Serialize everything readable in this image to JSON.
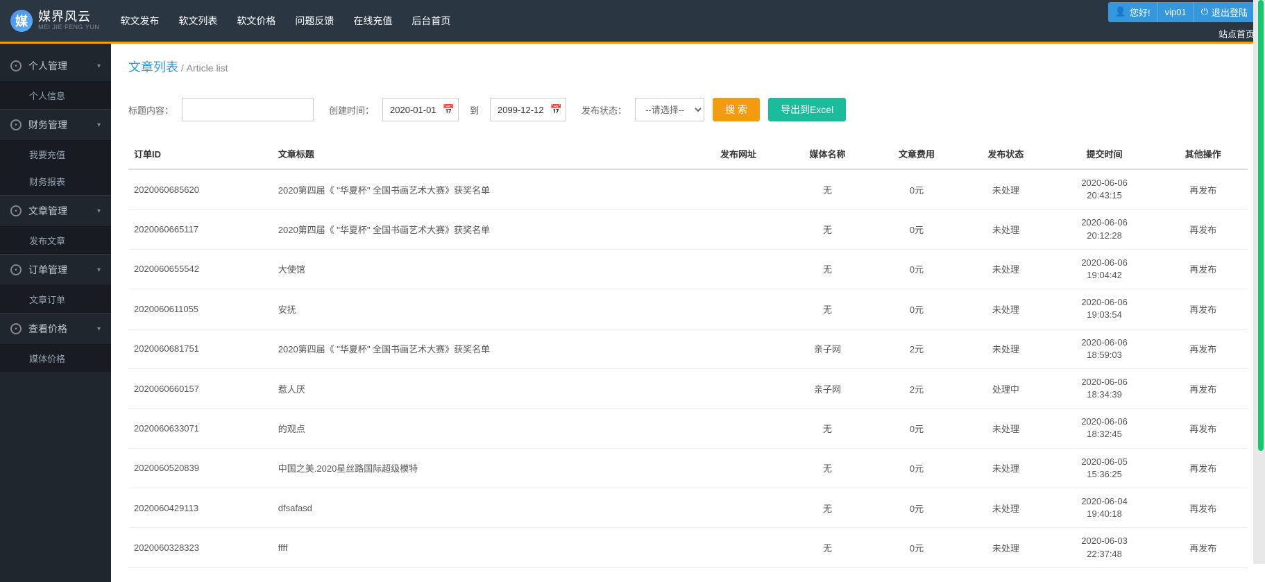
{
  "brand": {
    "icon_text": "媒",
    "name_cn": "媒界风云",
    "name_en": "MEI JIE FENG YUN"
  },
  "top_nav": [
    "软文发布",
    "软文列表",
    "软文价格",
    "问题反馈",
    "在线充值",
    "后台首页"
  ],
  "user_area": {
    "greeting": "您好!",
    "username": "vip01",
    "logout": "退出登陆",
    "site_home": "站点首页"
  },
  "sidebar": [
    {
      "label": "个人管理",
      "items": [
        "个人信息"
      ]
    },
    {
      "label": "财务管理",
      "items": [
        "我要充值",
        "财务报表"
      ]
    },
    {
      "label": "文章管理",
      "items": [
        "发布文章"
      ]
    },
    {
      "label": "订单管理",
      "items": [
        "文章订单"
      ]
    },
    {
      "label": "查看价格",
      "items": [
        "媒体价格"
      ]
    }
  ],
  "page": {
    "title_cn": "文章列表",
    "title_sep": " / ",
    "title_en": "Article list"
  },
  "filters": {
    "title_label": "标题内容：",
    "title_value": "",
    "create_time_label": "创建时间：",
    "date_from": "2020-01-01",
    "to_label": "到",
    "date_to": "2099-12-12",
    "status_label": "发布状态：",
    "status_placeholder": "--请选择--",
    "search_btn": "搜 索",
    "export_btn": "导出到Excel"
  },
  "table": {
    "headers": [
      "订单ID",
      "文章标题",
      "发布网址",
      "媒体名称",
      "文章费用",
      "发布状态",
      "提交时间",
      "其他操作"
    ],
    "rows": [
      {
        "id": "2020060685620",
        "title": "2020第四届《 \"华夏杯\" 全国书画艺术大赛》获奖名单",
        "url": "",
        "media": "无",
        "fee": "0元",
        "status": "未处理",
        "status_class": "green",
        "time1": "2020-06-06",
        "time2": "20:43:15",
        "action": "再发布"
      },
      {
        "id": "2020060665117",
        "title": "2020第四届《 \"华夏杯\" 全国书画艺术大赛》获奖名单",
        "url": "",
        "media": "无",
        "fee": "0元",
        "status": "未处理",
        "status_class": "green",
        "time1": "2020-06-06",
        "time2": "20:12:28",
        "action": "再发布"
      },
      {
        "id": "2020060655542",
        "title": "大使馆",
        "url": "",
        "media": "无",
        "fee": "0元",
        "status": "未处理",
        "status_class": "green",
        "time1": "2020-06-06",
        "time2": "19:04:42",
        "action": "再发布"
      },
      {
        "id": "2020060611055",
        "title": "安抚",
        "url": "",
        "media": "无",
        "fee": "0元",
        "status": "未处理",
        "status_class": "green",
        "time1": "2020-06-06",
        "time2": "19:03:54",
        "action": "再发布"
      },
      {
        "id": "2020060681751",
        "title": "2020第四届《 \"华夏杯\" 全国书画艺术大赛》获奖名单",
        "url": "",
        "media": "亲子网",
        "fee": "2元",
        "status": "未处理",
        "status_class": "green",
        "time1": "2020-06-06",
        "time2": "18:59:03",
        "action": "再发布"
      },
      {
        "id": "2020060660157",
        "title": "惹人厌",
        "url": "",
        "media": "亲子网",
        "fee": "2元",
        "status": "处理中",
        "status_class": "red",
        "time1": "2020-06-06",
        "time2": "18:34:39",
        "action": "再发布"
      },
      {
        "id": "2020060633071",
        "title": "的观点",
        "url": "",
        "media": "无",
        "fee": "0元",
        "status": "未处理",
        "status_class": "green",
        "time1": "2020-06-06",
        "time2": "18:32:45",
        "action": "再发布"
      },
      {
        "id": "2020060520839",
        "title": "中国之美.2020星丝路国际超级模特",
        "url": "",
        "media": "无",
        "fee": "0元",
        "status": "未处理",
        "status_class": "green",
        "time1": "2020-06-05",
        "time2": "15:36:25",
        "action": "再发布"
      },
      {
        "id": "2020060429113",
        "title": "dfsafasd",
        "url": "",
        "media": "无",
        "fee": "0元",
        "status": "未处理",
        "status_class": "green",
        "time1": "2020-06-04",
        "time2": "19:40:18",
        "action": "再发布"
      },
      {
        "id": "2020060328323",
        "title": "ffff",
        "url": "",
        "media": "无",
        "fee": "0元",
        "status": "未处理",
        "status_class": "green",
        "time1": "2020-06-03",
        "time2": "22:37:48",
        "action": "再发布"
      }
    ]
  }
}
